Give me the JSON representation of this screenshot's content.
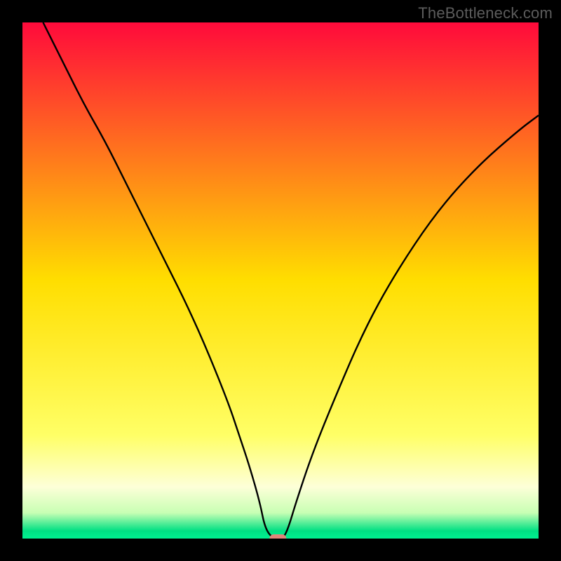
{
  "watermark": "TheBottleneck.com",
  "chart_data": {
    "type": "line",
    "title": "",
    "xlabel": "",
    "ylabel": "",
    "xlim": [
      0,
      100
    ],
    "ylim": [
      0,
      100
    ],
    "background_gradient": {
      "stops": [
        {
          "offset": 0.0,
          "color": "#ff0a3b"
        },
        {
          "offset": 0.5,
          "color": "#ffde00"
        },
        {
          "offset": 0.8,
          "color": "#ffff66"
        },
        {
          "offset": 0.9,
          "color": "#fdffd8"
        },
        {
          "offset": 0.95,
          "color": "#c8ffb4"
        },
        {
          "offset": 0.985,
          "color": "#00e083"
        },
        {
          "offset": 1.0,
          "color": "#00f090"
        }
      ]
    },
    "series": [
      {
        "name": "bottleneck-curve",
        "color": "#000000",
        "x": [
          4,
          8,
          12,
          16,
          20,
          24,
          28,
          32,
          36,
          40,
          42,
          44,
          46,
          47,
          48.5,
          50.5,
          51.5,
          53,
          56,
          60,
          66,
          72,
          80,
          88,
          96,
          100
        ],
        "y": [
          100,
          92,
          84,
          77,
          69,
          61,
          53,
          45,
          36,
          26,
          20,
          14,
          7,
          2,
          0,
          0,
          2,
          7,
          16,
          26,
          40,
          51,
          63,
          72,
          79,
          82
        ]
      }
    ],
    "marker": {
      "x": 49.5,
      "y": 0,
      "color": "#e0857a",
      "name": "current-point"
    }
  }
}
